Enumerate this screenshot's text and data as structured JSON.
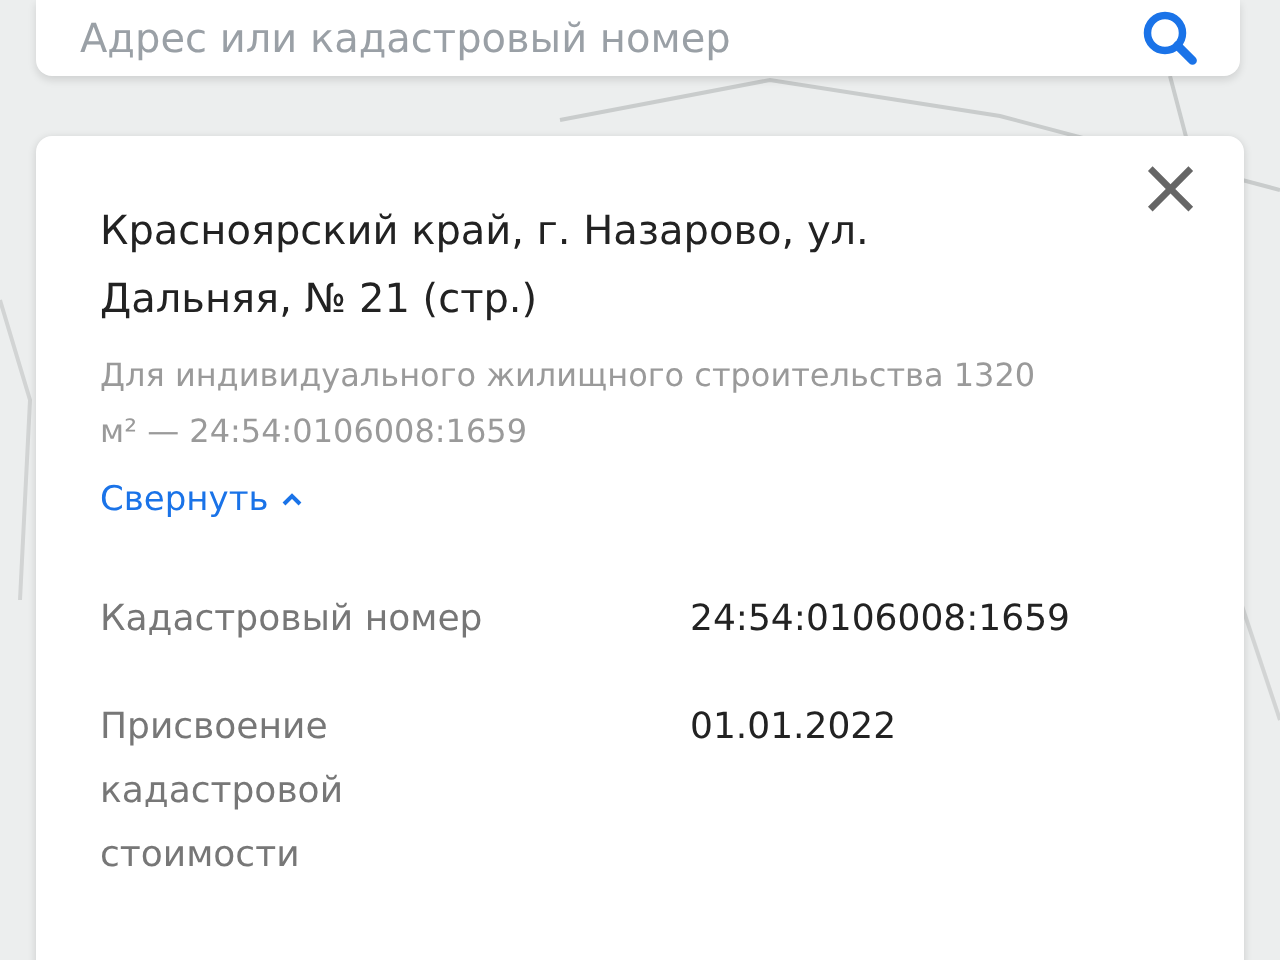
{
  "search": {
    "placeholder": "Адрес или кадастровый номер"
  },
  "card": {
    "close": "×",
    "title": "Красноярский край, г. Назарово, ул. Дальняя, № 21 (стр.)",
    "subtitle": "Для индивидуального жилищного строительства 1320 м² — 24:54:0106008:1659",
    "toggle": {
      "label": "Свернуть",
      "expanded": true
    },
    "details": [
      {
        "label": "Кадастровый номер",
        "value": "24:54:0106008:1659"
      },
      {
        "label": "Присвоение кадастровой стоимости",
        "value": "01.01.2022"
      }
    ]
  }
}
